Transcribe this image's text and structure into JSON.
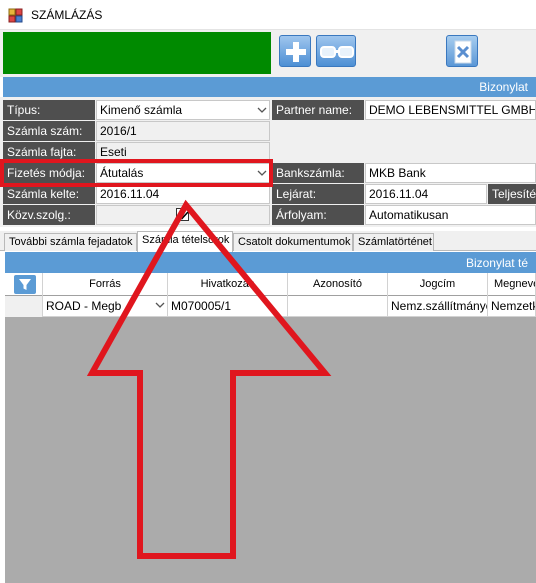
{
  "window": {
    "title": "SZÁMLÁZÁS",
    "icon": "app-icon"
  },
  "toolbar": {
    "buttons": [
      {
        "name": "add",
        "icon": "plus-icon"
      },
      {
        "name": "view",
        "icon": "glasses-icon"
      },
      {
        "name": "delete",
        "icon": "document-x-icon"
      }
    ]
  },
  "header_bar": {
    "text": "Bizonylat"
  },
  "form": {
    "tipus": {
      "label": "Típus:",
      "value": "Kimenő számla"
    },
    "partner": {
      "label": "Partner name:",
      "value": "DEMO LEBENSMITTEL GMBH"
    },
    "szamla_szam": {
      "label": "Számla szám:",
      "value": "2016/1"
    },
    "szamla_fajta": {
      "label": "Számla fajta:",
      "value": "Eseti"
    },
    "fizetes_modja": {
      "label": "Fizetés módja:",
      "value": "Átutalás"
    },
    "bankszamla": {
      "label": "Bankszámla:",
      "value": "MKB Bank"
    },
    "szamla_kelte": {
      "label": "Számla kelte:",
      "value": "2016.11.04"
    },
    "lejarat": {
      "label": "Lejárat:",
      "value": "2016.11.04"
    },
    "teljesites": {
      "label": "Teljesíté"
    },
    "kozv_szolg": {
      "label": "Közv.szolg.:",
      "checked": true
    },
    "arfolyam": {
      "label": "Árfolyam:",
      "value": "Automatikusan"
    }
  },
  "tabs": [
    {
      "label": "További számla fejadatok",
      "active": false
    },
    {
      "label": "Számla tételsorok",
      "active": true
    },
    {
      "label": "Csatolt dokumentumok",
      "active": false
    },
    {
      "label": "Számlatörténet",
      "active": false
    }
  ],
  "grid": {
    "title": "Bizonylat té",
    "columns": [
      "Forrás",
      "Hivatkozás",
      "Azonosító",
      "Jogcím",
      "Megneve"
    ],
    "rows": [
      {
        "forras": "ROAD - Megb",
        "hivatkozas": "M070005/1",
        "azonosito": "",
        "jogcim": "Nemz.szállítmányo",
        "megnevezes": "Nemzetk"
      }
    ]
  },
  "colors": {
    "green_panel": "#008a00",
    "header_blue": "#5b9bd5",
    "label_bg": "#4f4f4f",
    "highlight_red": "#e0161e"
  },
  "annotations": {
    "highlight_target": "fizetes_modja",
    "arrow": "up-arrow-icon"
  }
}
